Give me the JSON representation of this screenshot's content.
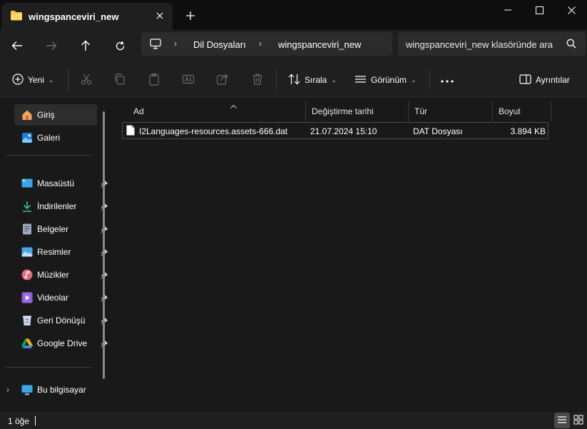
{
  "window": {
    "tab_title": "wingspanceviri_new",
    "close_tab_glyph": "✕",
    "new_tab_glyph": "+"
  },
  "address": {
    "crumbs": [
      "Dil Dosyaları",
      "wingspanceviri_new"
    ],
    "search_placeholder": "wingspanceviri_new klasöründe ara"
  },
  "toolbar": {
    "new_label": "Yeni",
    "sort_label": "Sırala",
    "view_label": "Görünüm",
    "more_glyph": "•••",
    "details_label": "Ayrıntılar"
  },
  "sidebar": {
    "home_label": "Giriş",
    "gallery_label": "Galeri",
    "items": [
      {
        "label": "Masaüstü",
        "icon": "desktop-icon",
        "color": "#3ba7e8"
      },
      {
        "label": "İndirilenler",
        "icon": "downloads-icon",
        "color": "#36c0a0"
      },
      {
        "label": "Belgeler",
        "icon": "documents-icon",
        "color": "#9aa9bd"
      },
      {
        "label": "Resimler",
        "icon": "pictures-icon",
        "color": "#4aa3e6"
      },
      {
        "label": "Müzikler",
        "icon": "music-icon",
        "color": "#e4697a"
      },
      {
        "label": "Videolar",
        "icon": "videos-icon",
        "color": "#9b6ae6"
      },
      {
        "label": "Geri Dönüşüm Kutusu",
        "icon": "recycle-bin-icon",
        "color": "#c8d3de"
      },
      {
        "label": "Google Drive",
        "icon": "google-drive-icon",
        "color": "#f4b400"
      }
    ],
    "this_pc_label": "Bu bilgisayar"
  },
  "columns": {
    "name": "Ad",
    "modified": "Değiştirme tarihi",
    "type": "Tür",
    "size": "Boyut"
  },
  "files": [
    {
      "name": "I2Languages-resources.assets-666.dat",
      "modified": "21.07.2024 15:10",
      "type": "DAT Dosyası",
      "size": "3.894 KB"
    }
  ],
  "status": {
    "item_count": "1 öğe"
  },
  "colors": {
    "accent": "#4cc2ff",
    "folder": "#f7c244",
    "background": "#191919"
  }
}
